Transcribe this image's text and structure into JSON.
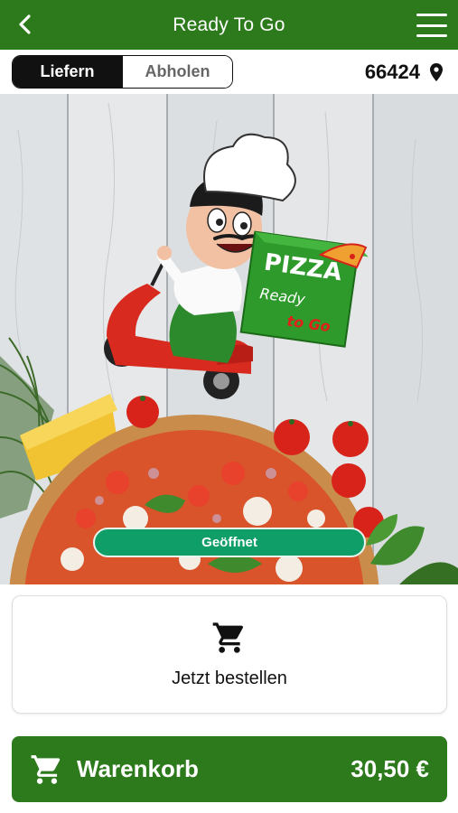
{
  "header": {
    "title": "Ready To Go",
    "back_icon": "chevron-left-icon",
    "menu_icon": "hamburger-menu-icon"
  },
  "mode": {
    "options": [
      "Liefern",
      "Abholen"
    ],
    "selected": "Liefern"
  },
  "location": {
    "zip": "66424",
    "icon": "location-pin-icon"
  },
  "hero": {
    "logo_lines": [
      "PIZZA",
      "Ready",
      "to Go"
    ],
    "status": "Geöffnet"
  },
  "order": {
    "label": "Jetzt bestellen",
    "icon": "shopping-cart-icon"
  },
  "basket": {
    "label": "Warenkorb",
    "total": "30,50 €",
    "icon": "shopping-cart-icon"
  },
  "colors": {
    "brand_green": "#2c7a1b",
    "status_green": "#0f9e68",
    "dark": "#111111"
  }
}
